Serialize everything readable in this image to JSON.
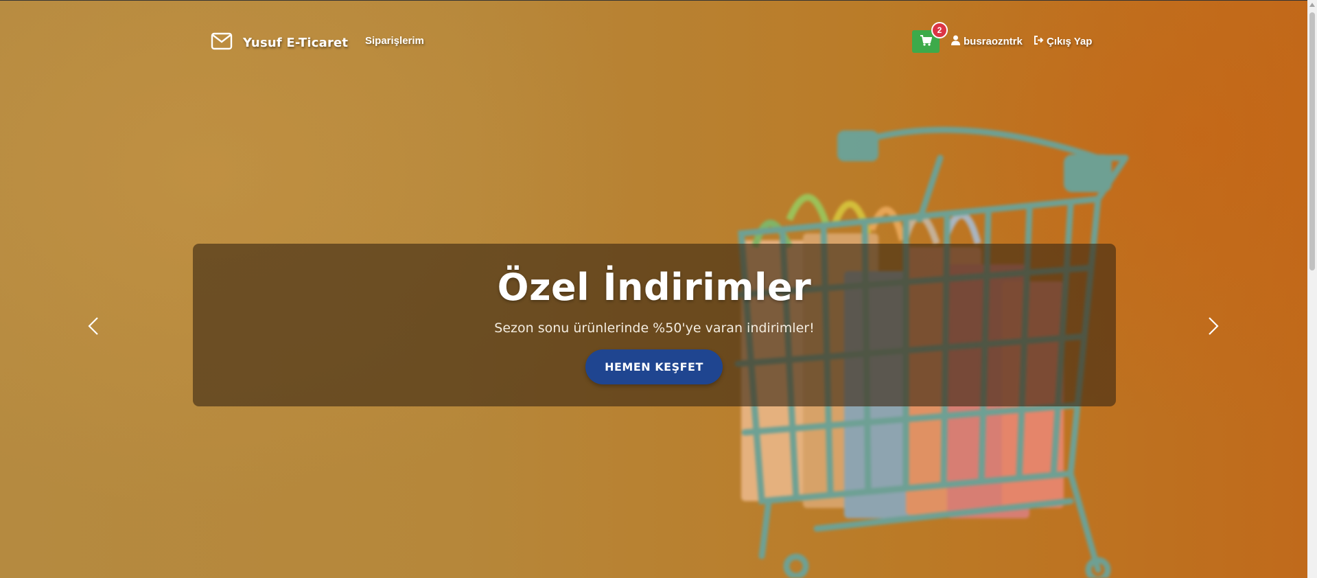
{
  "navbar": {
    "brand": "Yusuf E-Ticaret",
    "orders_link": "Siparişlerim",
    "cart_badge_count": "2",
    "username": "busraozntrk",
    "logout": "Çıkış Yap",
    "icons": {
      "brand": "envelope-icon",
      "cart": "shopping-cart-icon",
      "user": "user-icon",
      "logout": "sign-out-icon"
    }
  },
  "carousel": {
    "title": "Özel İndirimler",
    "subtitle": "Sezon sonu ürünlerinde %50'ye varan indirimler!",
    "cta_label": "HEMEN KEŞFET",
    "prev_icon": "chevron-left-icon",
    "next_icon": "chevron-right-icon"
  },
  "colors": {
    "cart_button": "#3daa4a",
    "badge": "#dc3545",
    "cta_button": "#1f4590",
    "caption_overlay": "rgba(60,40,20,0.62)"
  }
}
